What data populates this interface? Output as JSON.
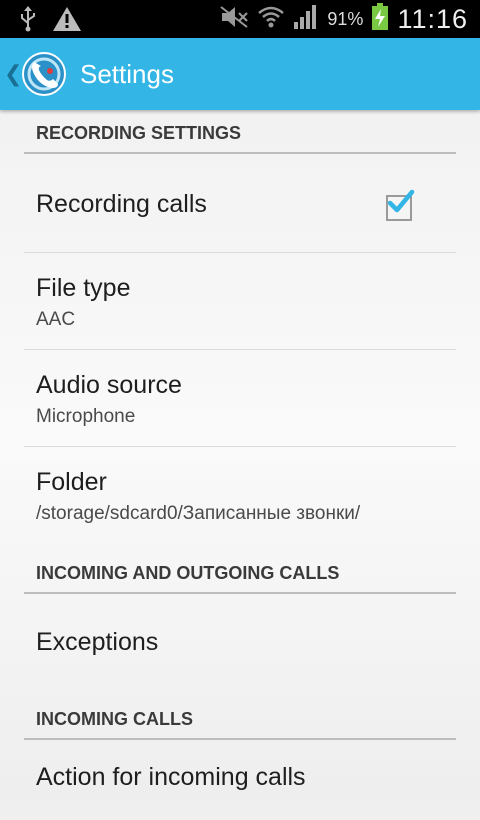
{
  "status_bar": {
    "battery_percent": "91%",
    "time": "11:16",
    "icons": [
      "usb-icon",
      "warning-icon",
      "mute-icon",
      "wifi-icon",
      "signal-icon",
      "battery-charging-icon"
    ]
  },
  "action_bar": {
    "title": "Settings",
    "color": "#33b5e5",
    "icons": [
      "back-chevron-icon",
      "app-phone-icon"
    ]
  },
  "sections": [
    {
      "header": "RECORDING SETTINGS",
      "items": [
        {
          "title": "Recording calls",
          "checked": true
        },
        {
          "title": "File type",
          "summary": "AAC"
        },
        {
          "title": "Audio source",
          "summary": "Microphone"
        },
        {
          "title": "Folder",
          "summary": "/storage/sdcard0/Записанные звонки/"
        }
      ]
    },
    {
      "header": "INCOMING AND OUTGOING CALLS",
      "items": [
        {
          "title": "Exceptions"
        }
      ]
    },
    {
      "header": "INCOMING CALLS",
      "items": [
        {
          "title": "Action for incoming calls"
        }
      ]
    }
  ]
}
